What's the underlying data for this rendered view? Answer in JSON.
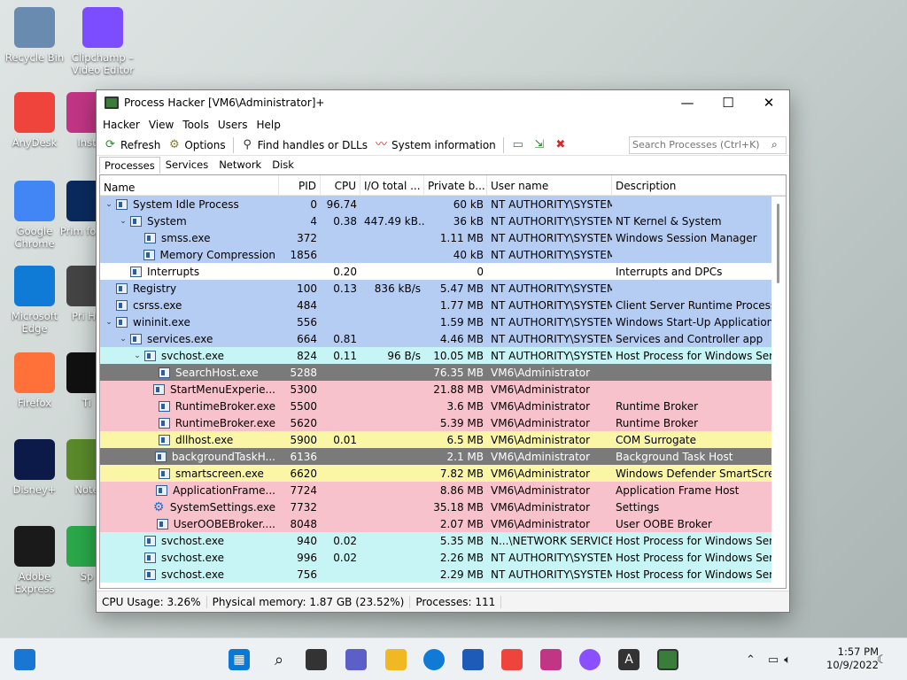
{
  "desktop": {
    "icons": [
      {
        "label": "Recycle Bin",
        "color": "#6a8bb0"
      },
      {
        "label": "Clipchamp – Video Editor",
        "color": "#7c4dff"
      },
      {
        "label": "AnyDesk",
        "color": "#ef443b"
      },
      {
        "label": "Google Chrome",
        "color": "#4285f4"
      },
      {
        "label": "Microsoft Edge",
        "color": "#0f7bd6"
      },
      {
        "label": "Firefox",
        "color": "#ff7139"
      },
      {
        "label": "Disney+",
        "color": "#0b1a48"
      },
      {
        "label": "Adobe Express",
        "color": "#1a1a1a"
      },
      {
        "label": "Inst",
        "color": "#c13584"
      },
      {
        "label": "Prim for W",
        "color": "#0a2a5e"
      },
      {
        "label": "Pri Ha",
        "color": "#444444"
      },
      {
        "label": "Ti",
        "color": "#111111"
      },
      {
        "label": "Note",
        "color": "#5a8a2b"
      },
      {
        "label": "Sp",
        "color": "#2aa84a"
      }
    ]
  },
  "window": {
    "title": "Process Hacker [VM6\\Administrator]+",
    "controls": {
      "minimize": "—",
      "maximize": "☐",
      "close": "✕"
    },
    "menu": [
      "Hacker",
      "View",
      "Tools",
      "Users",
      "Help"
    ],
    "toolbar": {
      "refresh": "Refresh",
      "options": "Options",
      "find_handles": "Find handles or DLLs",
      "system_info": "System information",
      "search_placeholder": "Search Processes (Ctrl+K)"
    },
    "tabs": [
      "Processes",
      "Services",
      "Network",
      "Disk"
    ],
    "active_tab": "Processes",
    "columns": [
      "Name",
      "PID",
      "CPU",
      "I/O total ...",
      "Private b...",
      "User name",
      "Description"
    ],
    "rows": [
      {
        "name": "System Idle Process",
        "pid": "0",
        "cpu": "96.74",
        "io": "",
        "priv": "60 kB",
        "user": "NT AUTHORITY\\SYSTEM",
        "desc": "",
        "indent": 0,
        "expander": "⌄",
        "color": "blue"
      },
      {
        "name": "System",
        "pid": "4",
        "cpu": "0.38",
        "io": "447.49 kB...",
        "priv": "36 kB",
        "user": "NT AUTHORITY\\SYSTEM",
        "desc": "NT Kernel & System",
        "indent": 1,
        "expander": "⌄",
        "color": "blue"
      },
      {
        "name": "smss.exe",
        "pid": "372",
        "cpu": "",
        "io": "",
        "priv": "1.11 MB",
        "user": "NT AUTHORITY\\SYSTEM",
        "desc": "Windows Session Manager",
        "indent": 2,
        "expander": "",
        "color": "blue"
      },
      {
        "name": "Memory Compression",
        "pid": "1856",
        "cpu": "",
        "io": "",
        "priv": "40 kB",
        "user": "NT AUTHORITY\\SYSTEM",
        "desc": "",
        "indent": 2,
        "expander": "",
        "color": "blue"
      },
      {
        "name": "Interrupts",
        "pid": "",
        "cpu": "0.20",
        "io": "",
        "priv": "0",
        "user": "",
        "desc": "Interrupts and DPCs",
        "indent": 1,
        "expander": "",
        "color": "white"
      },
      {
        "name": "Registry",
        "pid": "100",
        "cpu": "0.13",
        "io": "836 kB/s",
        "priv": "5.47 MB",
        "user": "NT AUTHORITY\\SYSTEM",
        "desc": "",
        "indent": 0,
        "expander": "",
        "color": "blue"
      },
      {
        "name": "csrss.exe",
        "pid": "484",
        "cpu": "",
        "io": "",
        "priv": "1.77 MB",
        "user": "NT AUTHORITY\\SYSTEM",
        "desc": "Client Server Runtime Process",
        "indent": 0,
        "expander": "",
        "color": "blue"
      },
      {
        "name": "wininit.exe",
        "pid": "556",
        "cpu": "",
        "io": "",
        "priv": "1.59 MB",
        "user": "NT AUTHORITY\\SYSTEM",
        "desc": "Windows Start-Up Application",
        "indent": 0,
        "expander": "⌄",
        "color": "blue"
      },
      {
        "name": "services.exe",
        "pid": "664",
        "cpu": "0.81",
        "io": "",
        "priv": "4.46 MB",
        "user": "NT AUTHORITY\\SYSTEM",
        "desc": "Services and Controller app",
        "indent": 1,
        "expander": "⌄",
        "color": "blue"
      },
      {
        "name": "svchost.exe",
        "pid": "824",
        "cpu": "0.11",
        "io": "96 B/s",
        "priv": "10.05 MB",
        "user": "NT AUTHORITY\\SYSTEM",
        "desc": "Host Process for Windows Ser...",
        "indent": 2,
        "expander": "⌄",
        "color": "cyan"
      },
      {
        "name": "SearchHost.exe",
        "pid": "5288",
        "cpu": "",
        "io": "",
        "priv": "76.35 MB",
        "user": "VM6\\Administrator",
        "desc": "",
        "indent": 3,
        "expander": "",
        "color": "gray"
      },
      {
        "name": "StartMenuExperie...",
        "pid": "5300",
        "cpu": "",
        "io": "",
        "priv": "21.88 MB",
        "user": "VM6\\Administrator",
        "desc": "",
        "indent": 3,
        "expander": "",
        "color": "pink"
      },
      {
        "name": "RuntimeBroker.exe",
        "pid": "5500",
        "cpu": "",
        "io": "",
        "priv": "3.6 MB",
        "user": "VM6\\Administrator",
        "desc": "Runtime Broker",
        "indent": 3,
        "expander": "",
        "color": "pink"
      },
      {
        "name": "RuntimeBroker.exe",
        "pid": "5620",
        "cpu": "",
        "io": "",
        "priv": "5.39 MB",
        "user": "VM6\\Administrator",
        "desc": "Runtime Broker",
        "indent": 3,
        "expander": "",
        "color": "pink"
      },
      {
        "name": "dllhost.exe",
        "pid": "5900",
        "cpu": "0.01",
        "io": "",
        "priv": "6.5 MB",
        "user": "VM6\\Administrator",
        "desc": "COM Surrogate",
        "indent": 3,
        "expander": "",
        "color": "yellow"
      },
      {
        "name": "backgroundTaskH...",
        "pid": "6136",
        "cpu": "",
        "io": "",
        "priv": "2.1 MB",
        "user": "VM6\\Administrator",
        "desc": "Background Task Host",
        "indent": 3,
        "expander": "",
        "color": "gray"
      },
      {
        "name": "smartscreen.exe",
        "pid": "6620",
        "cpu": "",
        "io": "",
        "priv": "7.82 MB",
        "user": "VM6\\Administrator",
        "desc": "Windows Defender SmartScre...",
        "indent": 3,
        "expander": "",
        "color": "yellow"
      },
      {
        "name": "ApplicationFrame...",
        "pid": "7724",
        "cpu": "",
        "io": "",
        "priv": "8.86 MB",
        "user": "VM6\\Administrator",
        "desc": "Application Frame Host",
        "indent": 3,
        "expander": "",
        "color": "pink"
      },
      {
        "name": "SystemSettings.exe",
        "pid": "7732",
        "cpu": "",
        "io": "",
        "priv": "35.18 MB",
        "user": "VM6\\Administrator",
        "desc": "Settings",
        "indent": 3,
        "expander": "",
        "color": "pink",
        "icon": "gear"
      },
      {
        "name": "UserOOBEBroker....",
        "pid": "8048",
        "cpu": "",
        "io": "",
        "priv": "2.07 MB",
        "user": "VM6\\Administrator",
        "desc": "User OOBE Broker",
        "indent": 3,
        "expander": "",
        "color": "pink"
      },
      {
        "name": "svchost.exe",
        "pid": "940",
        "cpu": "0.02",
        "io": "",
        "priv": "5.35 MB",
        "user": "N...\\NETWORK SERVICE",
        "desc": "Host Process for Windows Ser...",
        "indent": 2,
        "expander": "",
        "color": "cyan"
      },
      {
        "name": "svchost.exe",
        "pid": "996",
        "cpu": "0.02",
        "io": "",
        "priv": "2.26 MB",
        "user": "NT AUTHORITY\\SYSTEM",
        "desc": "Host Process for Windows Ser...",
        "indent": 2,
        "expander": "",
        "color": "cyan"
      },
      {
        "name": "svchost.exe",
        "pid": "756",
        "cpu": "",
        "io": "",
        "priv": "2.29 MB",
        "user": "NT AUTHORITY\\SYSTEM",
        "desc": "Host Process for Windows Ser...",
        "indent": 2,
        "expander": "",
        "color": "cyan"
      }
    ],
    "status": {
      "cpu": "CPU Usage: 3.26%",
      "memory": "Physical memory: 1.87 GB (23.52%)",
      "processes": "Processes: 111"
    }
  },
  "taskbar": {
    "time": "1:57 PM",
    "date": "10/9/2022"
  }
}
